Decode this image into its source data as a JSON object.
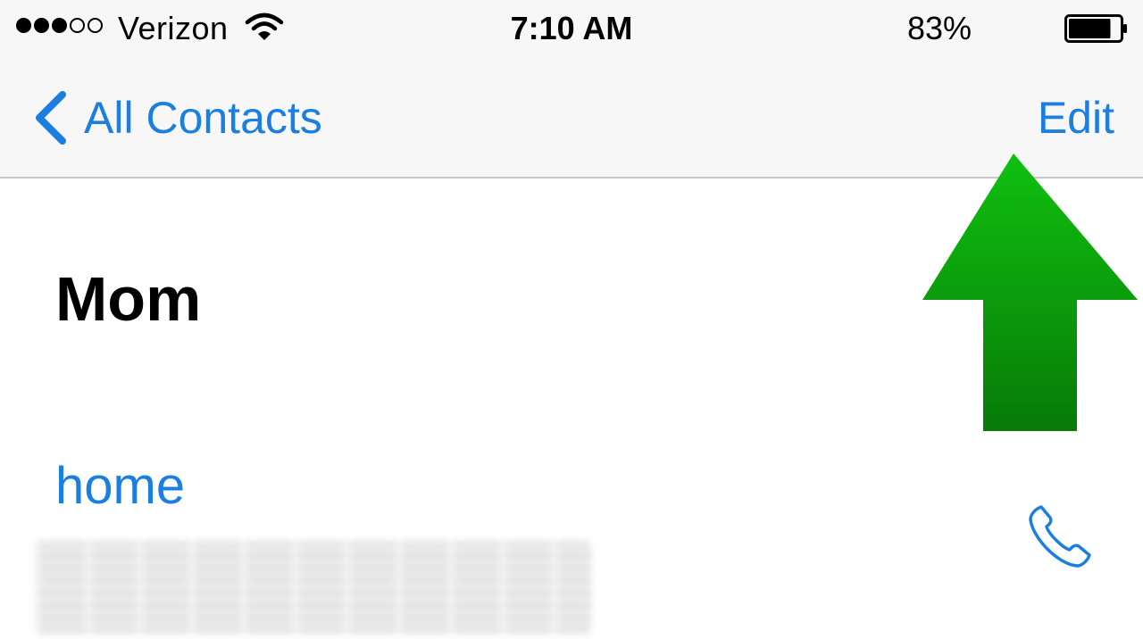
{
  "status_bar": {
    "signal_bars": [
      true,
      true,
      true,
      false,
      false
    ],
    "carrier": "Verizon",
    "wifi_icon": "wifi-icon",
    "time": "7:10 AM",
    "battery_percent": "83%",
    "battery_level": 0.83,
    "battery_icon": "battery-icon"
  },
  "nav_bar": {
    "back_icon": "chevron-left-icon",
    "back_label": "All Contacts",
    "edit_label": "Edit"
  },
  "contact": {
    "name": "Mom",
    "phone": {
      "label": "home",
      "number_redacted": true,
      "call_icon": "phone-icon"
    }
  },
  "annotation": {
    "arrow_icon": "up-arrow-icon",
    "color": "#0a9a0a",
    "points_to": "Edit"
  },
  "colors": {
    "accent": "#1a7fe0",
    "navbar_bg": "#f7f7f7",
    "divider": "#c8c7cc"
  }
}
